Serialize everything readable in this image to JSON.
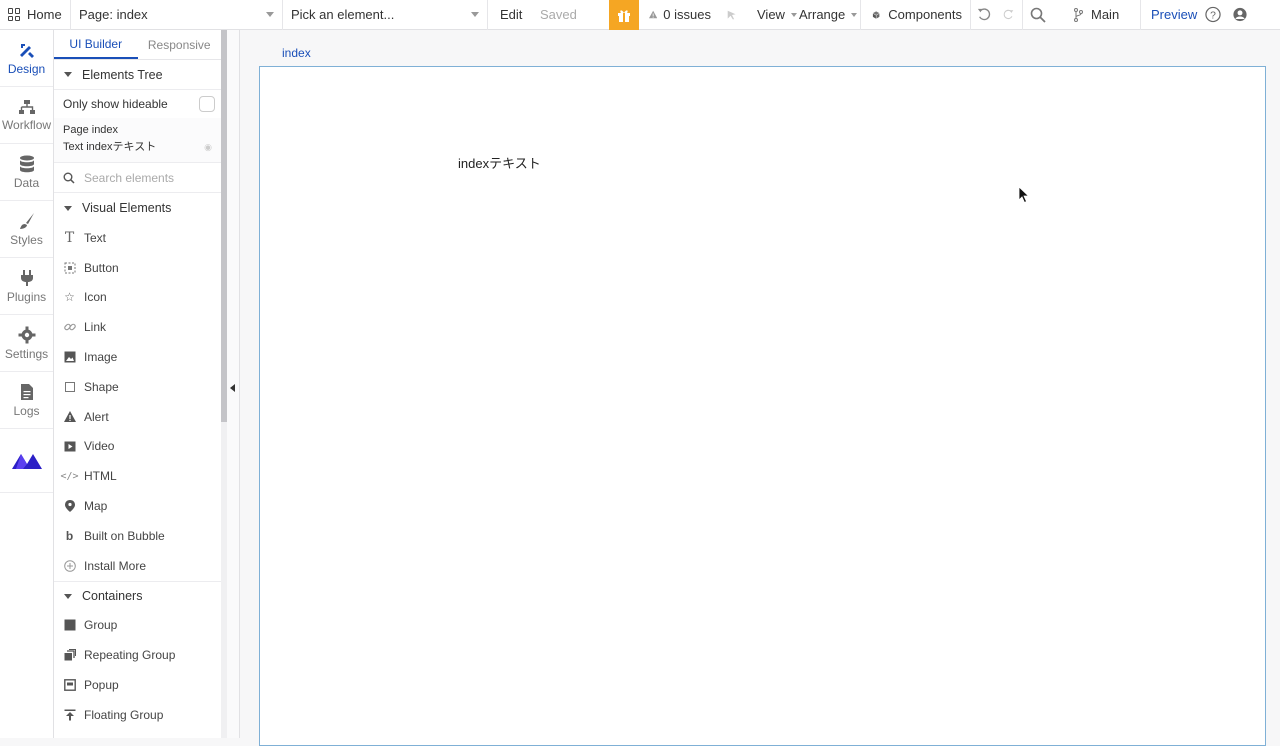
{
  "topbar": {
    "home_label": "Home",
    "page_select": "Page: index",
    "element_picker_placeholder": "Pick an element...",
    "edit_label": "Edit",
    "saved_label": "Saved",
    "issues_label": "0 issues",
    "view_label": "View",
    "arrange_label": "Arrange",
    "components_label": "Components",
    "branch_label": "Main",
    "preview_label": "Preview",
    "accent_color": "#f5a623"
  },
  "leftnav": {
    "items": [
      {
        "label": "Design",
        "icon": "design-icon"
      },
      {
        "label": "Workflow",
        "icon": "workflow-icon"
      },
      {
        "label": "Data",
        "icon": "database-icon"
      },
      {
        "label": "Styles",
        "icon": "brush-icon"
      },
      {
        "label": "Plugins",
        "icon": "plug-icon"
      },
      {
        "label": "Settings",
        "icon": "gear-icon"
      },
      {
        "label": "Logs",
        "icon": "document-icon"
      }
    ]
  },
  "panel": {
    "tabs": [
      "UI Builder",
      "Responsive"
    ],
    "elements_tree_title": "Elements Tree",
    "only_hideable_label": "Only show hideable",
    "tree": [
      "Page index",
      "Text indexテキスト"
    ],
    "search_placeholder": "Search elements",
    "visual_elements_title": "Visual Elements",
    "visual_elements": [
      {
        "label": "Text",
        "icon": "text-icon"
      },
      {
        "label": "Button",
        "icon": "button-icon"
      },
      {
        "label": "Icon",
        "icon": "star-icon"
      },
      {
        "label": "Link",
        "icon": "link-icon"
      },
      {
        "label": "Image",
        "icon": "image-icon"
      },
      {
        "label": "Shape",
        "icon": "square-icon"
      },
      {
        "label": "Alert",
        "icon": "alert-icon"
      },
      {
        "label": "Video",
        "icon": "video-icon"
      },
      {
        "label": "HTML",
        "icon": "code-icon"
      },
      {
        "label": "Map",
        "icon": "map-pin-icon"
      },
      {
        "label": "Built on Bubble",
        "icon": "bubble-icon"
      },
      {
        "label": "Install More",
        "icon": "plus-circle-icon"
      }
    ],
    "containers_title": "Containers",
    "containers": [
      {
        "label": "Group",
        "icon": "group-icon"
      },
      {
        "label": "Repeating Group",
        "icon": "repeating-group-icon"
      },
      {
        "label": "Popup",
        "icon": "popup-icon"
      },
      {
        "label": "Floating Group",
        "icon": "floating-group-icon"
      }
    ]
  },
  "canvas": {
    "page_label": "index",
    "text_content": "indexテキスト"
  }
}
